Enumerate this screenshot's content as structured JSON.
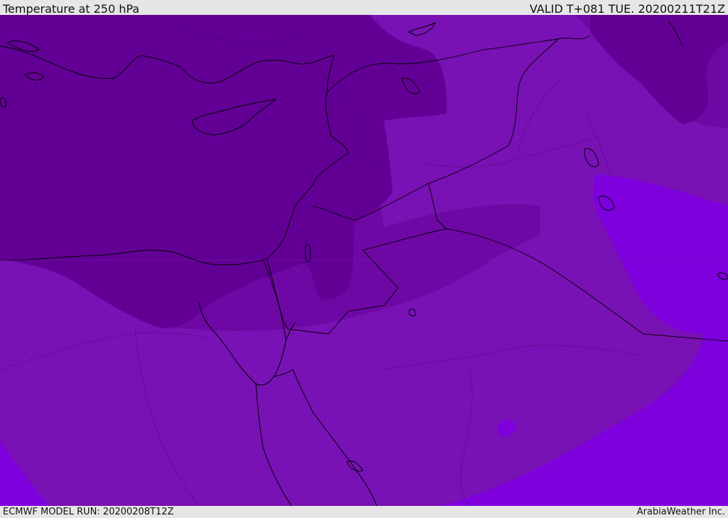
{
  "header": {
    "title": "Temperature at 250 hPa",
    "valid": "VALID T+081 TUE. 20200211T21Z"
  },
  "footer": {
    "model_run": "ECMWF MODEL RUN: 20200208T12Z",
    "credit": "ArabiaWeather Inc."
  },
  "colors": {
    "coldest": "#620096",
    "cold": "#6d08a4",
    "mid": "#7812b4",
    "warm": "#7e00dd",
    "coastline": "#000000",
    "background_bar": "#e6e6e6"
  }
}
